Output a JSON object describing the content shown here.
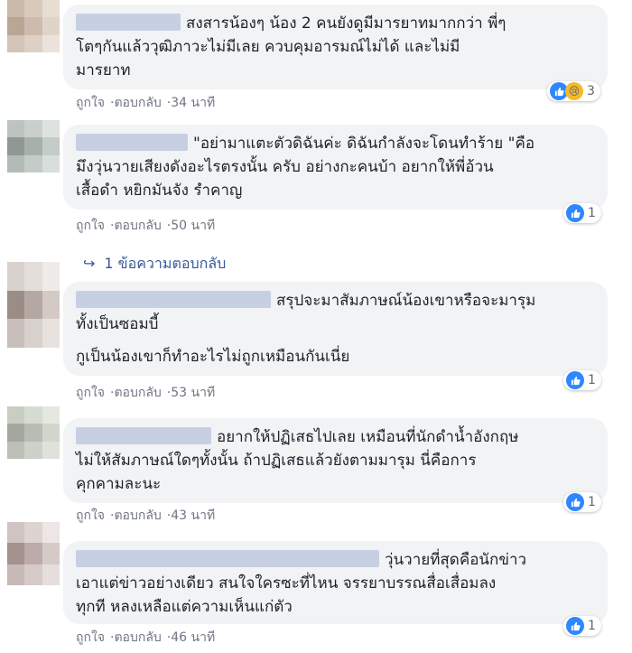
{
  "action_labels": {
    "like": "ถูกใจ",
    "reply": "ตอบกลับ"
  },
  "comments": [
    {
      "lines": [
        "สงสารน้องๆ น้อง 2 คนยังดูมีมารยาทมากกว่า พี่ๆ",
        "โตๆกันแล้ววุฒิภาวะไม่มีเลย ควบคุมอารมณ์ไม่ได้ และไม่มี",
        "มารยาท"
      ],
      "time": "34 นาที",
      "reaction_count": "3",
      "reactions": [
        "like-icon",
        "sad-icon"
      ]
    },
    {
      "lines": [
        "\"อย่ามาแตะตัวดิฉันค่ะ ดิฉันกำลังจะโดนทำร้าย \"คือ",
        "มึงวุ่นวายเสียงดังอะไรตรงนั้น ครับ อย่างกะคนบ้า อยากให้พี่อ้วน",
        "เสื้อดำ หยิกมันจัง รำคาญ"
      ],
      "time": "50 นาที",
      "reaction_count": "1",
      "reactions": [
        "like-icon"
      ]
    },
    {
      "lines": [
        "สรุปจะมาสัมภาษณ์น้องเขาหรือจะมารุม",
        "ทั้งเป็นซอมบี้",
        "กูเป็นน้องเขาก็ทำอะไรไม่ถูกเหมือนกันเนี่ย"
      ],
      "time": "53 นาที",
      "reaction_count": "1",
      "reactions": [
        "like-icon"
      ]
    },
    {
      "lines": [
        "อยากให้ปฏิเสธไปเลย เหมือนที่นักดำน้ำอังกฤษ",
        "ไม่ให้สัมภาษณ์ใดๆทั้งนั้น ถ้าปฏิเสธแล้วยังตามมารุม นี่คือการ",
        "คุกคามละนะ"
      ],
      "time": "43 นาที",
      "reaction_count": "1",
      "reactions": [
        "like-icon"
      ]
    },
    {
      "lines": [
        "วุ่นวายที่สุดคือนักข่าว",
        "เอาแต่ข่าวอย่างเดียว สนใจใครซะที่ไหน จรรยาบรรณสื่อเสื่อมลง",
        "ทุกที หลงเหลือแต่ความเห็นแก่ตัว"
      ],
      "time": "46 นาที",
      "reaction_count": "1",
      "reactions": [
        "like-icon"
      ]
    }
  ],
  "reply_link": "1 ข้อความตอบกลับ",
  "colors": {
    "bubble": "#f2f3f5",
    "link": "#385898",
    "like": "#2d88ff",
    "sad": "#f7b928",
    "meta": "#6f7583"
  }
}
